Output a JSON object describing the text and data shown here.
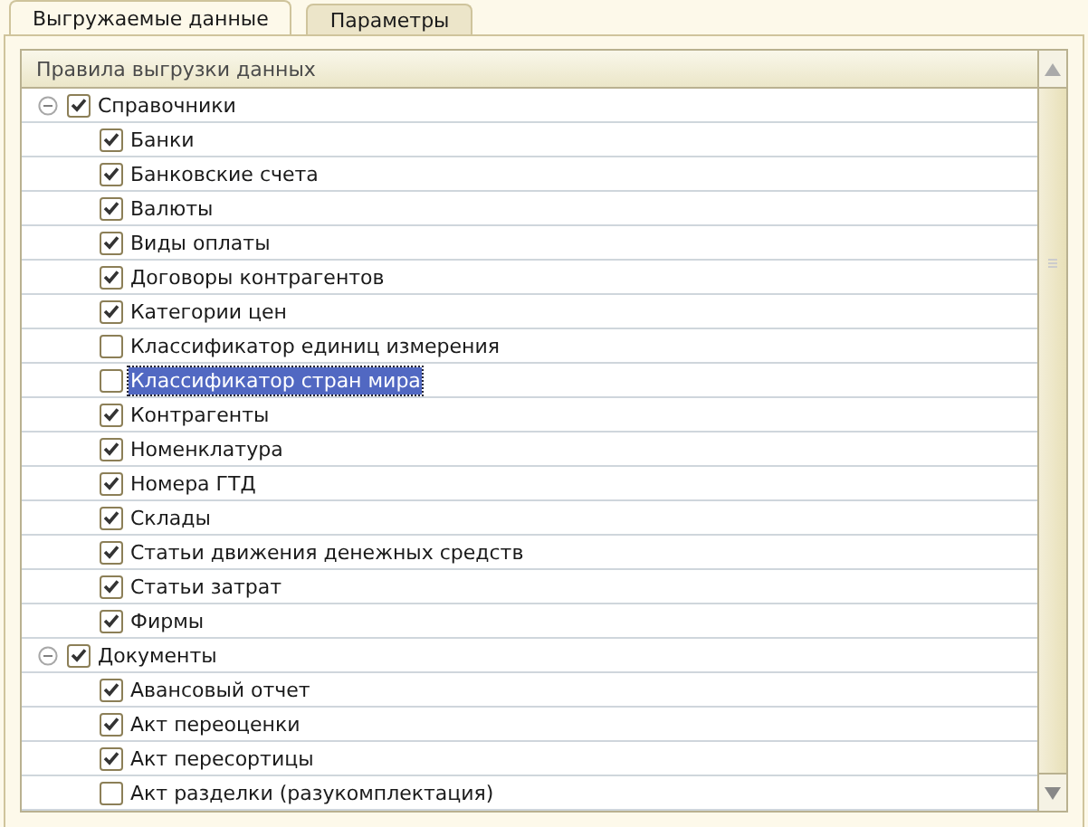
{
  "tabs": [
    {
      "label": "Выгружаемые данные",
      "selected": true
    },
    {
      "label": "Параметры",
      "selected": false
    }
  ],
  "table": {
    "column": "Правила выгрузки данных",
    "groups": [
      {
        "label": "Справочники",
        "checked": true,
        "expanded": true,
        "children": [
          {
            "label": "Банки",
            "checked": true,
            "selected": false
          },
          {
            "label": "Банковские счета",
            "checked": true,
            "selected": false
          },
          {
            "label": "Валюты",
            "checked": true,
            "selected": false
          },
          {
            "label": "Виды оплаты",
            "checked": true,
            "selected": false
          },
          {
            "label": "Договоры контрагентов",
            "checked": true,
            "selected": false
          },
          {
            "label": "Категории цен",
            "checked": true,
            "selected": false
          },
          {
            "label": "Классификатор единиц измерения",
            "checked": false,
            "selected": false
          },
          {
            "label": "Классификатор стран мира",
            "checked": false,
            "selected": true
          },
          {
            "label": "Контрагенты",
            "checked": true,
            "selected": false
          },
          {
            "label": "Номенклатура",
            "checked": true,
            "selected": false
          },
          {
            "label": "Номера ГТД",
            "checked": true,
            "selected": false
          },
          {
            "label": "Склады",
            "checked": true,
            "selected": false
          },
          {
            "label": "Статьи движения денежных средств",
            "checked": true,
            "selected": false
          },
          {
            "label": "Статьи затрат",
            "checked": true,
            "selected": false
          },
          {
            "label": "Фирмы",
            "checked": true,
            "selected": false
          }
        ]
      },
      {
        "label": "Документы",
        "checked": true,
        "expanded": true,
        "children": [
          {
            "label": "Авансовый отчет",
            "checked": true,
            "selected": false
          },
          {
            "label": "Акт переоценки",
            "checked": true,
            "selected": false
          },
          {
            "label": "Акт пересортицы",
            "checked": true,
            "selected": false
          },
          {
            "label": "Акт разделки (разукомплектация)",
            "checked": false,
            "selected": false
          }
        ]
      }
    ]
  }
}
